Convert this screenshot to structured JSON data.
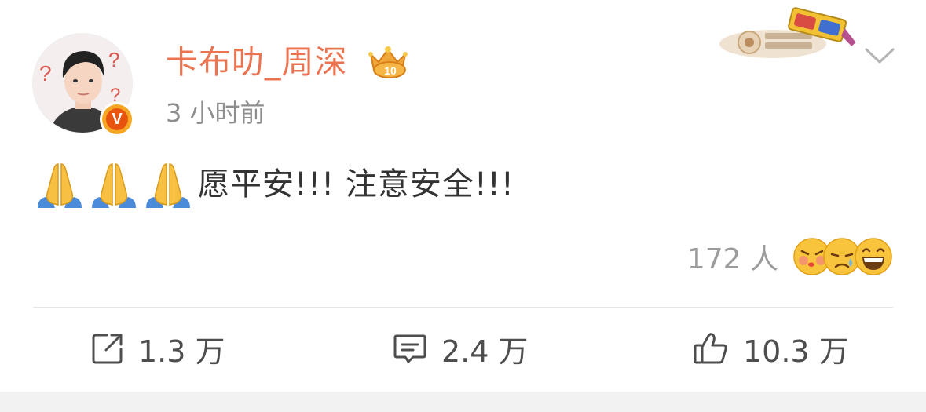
{
  "post": {
    "author": {
      "name": "卡布叻_周深",
      "verified_badge": "V",
      "badge_icon": "crown-level-10-icon",
      "level_label": "10",
      "avatar": "user-avatar"
    },
    "time": "3 小时前",
    "sticker": {
      "icon": "3d-glasses-sticker-icon"
    },
    "menu_icon": "chevron-down-icon",
    "content": {
      "emojis": [
        "folded-hands-icon",
        "folded-hands-icon",
        "folded-hands-icon"
      ],
      "text": "愿平安!!! 注意安全!!!"
    },
    "reactions": {
      "count": "172 人",
      "faces": [
        "kiss-face-icon",
        "crying-face-icon",
        "grin-face-icon"
      ]
    },
    "actions": {
      "repost": {
        "icon": "repost-icon",
        "count": "1.3 万"
      },
      "comment": {
        "icon": "comment-icon",
        "count": "2.4 万"
      },
      "like": {
        "icon": "thumbs-up-icon",
        "count": "10.3 万"
      }
    }
  },
  "colors": {
    "username": "#eb7350",
    "time": "#8e8e8e",
    "text": "#333333",
    "action": "#4e4e4e",
    "divider": "#e5e5e5"
  }
}
